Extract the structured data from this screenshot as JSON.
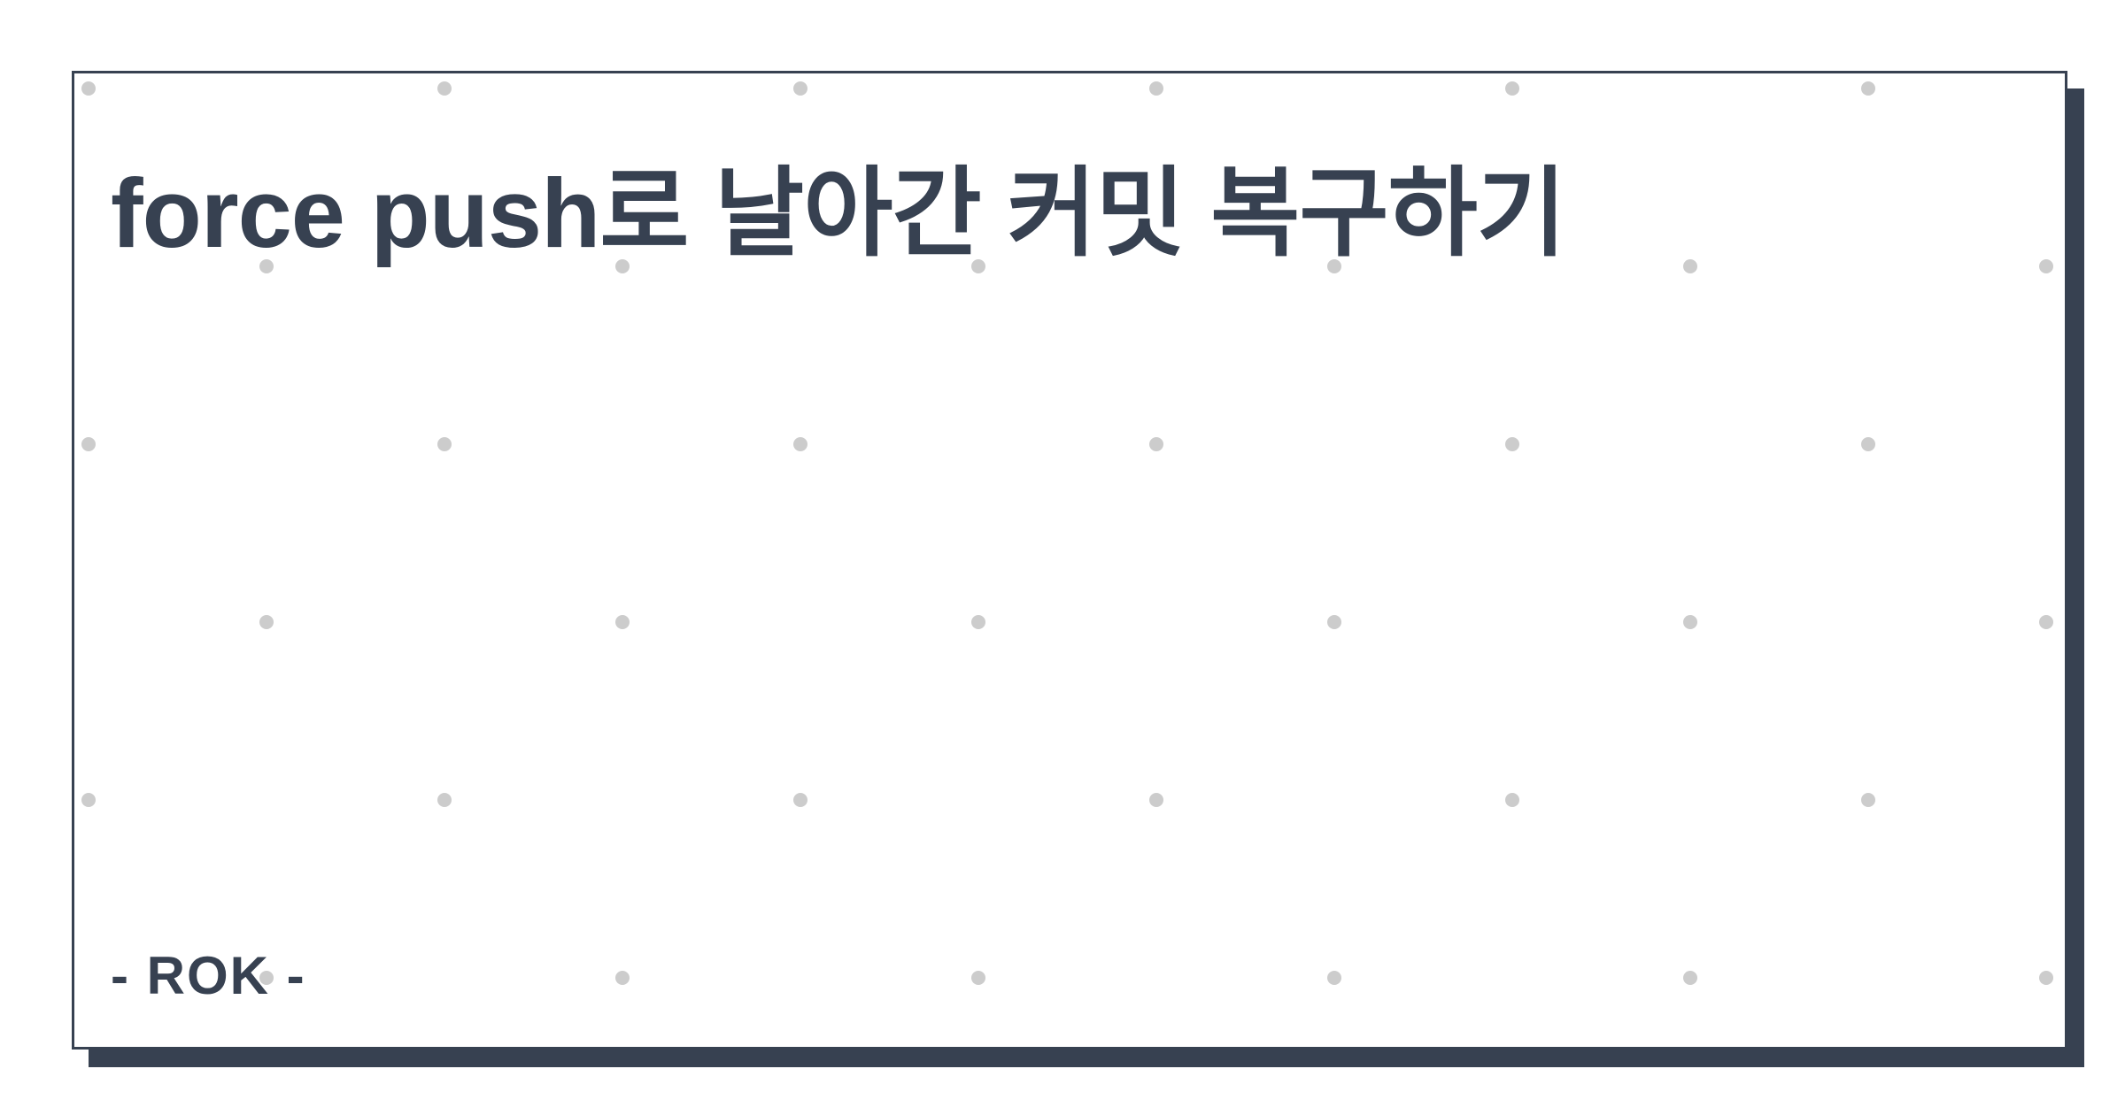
{
  "post": {
    "title": "force push로 날아간 커밋 복구하기",
    "author": "- ROK -"
  },
  "colors": {
    "text": "#374151",
    "border": "#374151",
    "shadow": "#374151",
    "dots": "#cccccc",
    "background": "#ffffff"
  }
}
